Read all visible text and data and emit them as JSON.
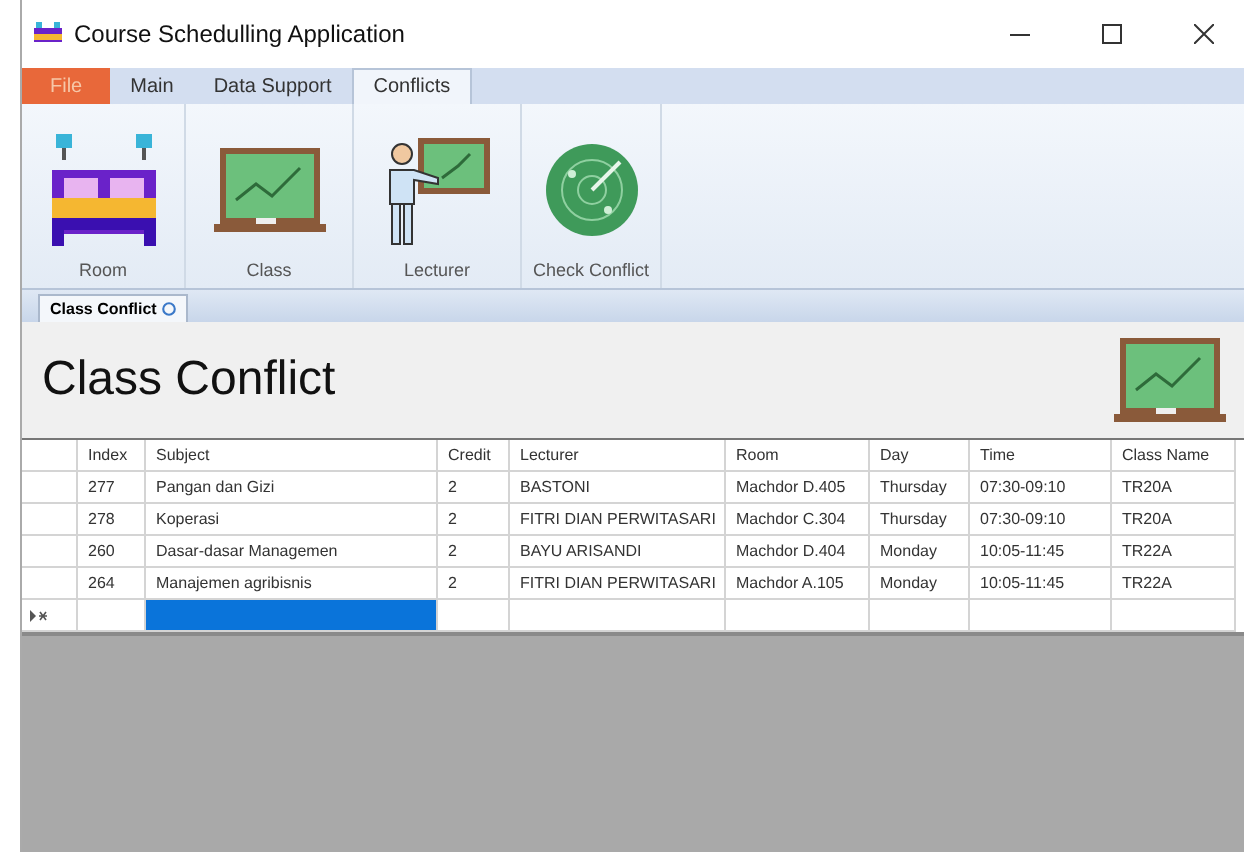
{
  "window": {
    "title": "Course Schedulling Application"
  },
  "ribbon_tabs": [
    {
      "label": "File",
      "kind": "file",
      "selected": false
    },
    {
      "label": "Main",
      "kind": "tab",
      "selected": false
    },
    {
      "label": "Data Support",
      "kind": "tab",
      "selected": false
    },
    {
      "label": "Conflicts",
      "kind": "tab",
      "selected": true
    }
  ],
  "ribbon_buttons": [
    {
      "label": "Room",
      "kind": "bed"
    },
    {
      "label": "Class",
      "kind": "board"
    },
    {
      "label": "Lecturer",
      "kind": "teacher"
    },
    {
      "label": "Check Conflict",
      "kind": "radar"
    }
  ],
  "document_tabs": [
    {
      "label": "Class Conflict",
      "selected": true
    }
  ],
  "page": {
    "heading": "Class Conflict"
  },
  "table": {
    "columns": [
      "Index",
      "Subject",
      "Credit",
      "Lecturer",
      "Room",
      "Day",
      "Time",
      "Class Name"
    ],
    "rows": [
      [
        "277",
        "Pangan dan Gizi",
        "2",
        "BASTONI",
        "Machdor D.405",
        "Thursday",
        "07:30-09:10",
        "TR20A"
      ],
      [
        "278",
        "Koperasi",
        "2",
        "FITRI DIAN PERWITASARI",
        "Machdor C.304",
        "Thursday",
        "07:30-09:10",
        "TR20A"
      ],
      [
        "260",
        "Dasar-dasar Managemen",
        "2",
        "BAYU ARISANDI",
        "Machdor D.404",
        "Monday",
        "10:05-11:45",
        "TR22A"
      ],
      [
        "264",
        "Manajemen agribisnis",
        "2",
        "FITRI DIAN PERWITASARI",
        "Machdor A.105",
        "Monday",
        "10:05-11:45",
        "TR22A"
      ]
    ],
    "new_row": {
      "cells_selected": [
        false,
        true,
        false,
        false,
        false,
        false,
        false,
        false
      ]
    }
  }
}
